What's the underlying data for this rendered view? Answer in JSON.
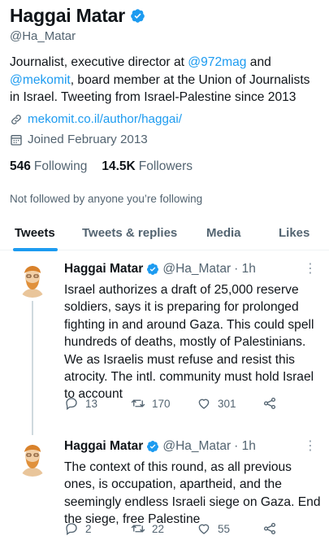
{
  "profile": {
    "display_name": "Haggai Matar",
    "handle": "@Ha_Matar",
    "bio_part1": "Journalist, executive director at ",
    "bio_mention1": "@972mag",
    "bio_part2": " and ",
    "bio_mention2": "@mekomit",
    "bio_part3": ", board member at the Union of Journalists in Israel. Tweeting from Israel-Palestine since 2013",
    "link": "mekomit.co.il/author/haggai/",
    "joined": "Joined February 2013",
    "following_count": "546",
    "following_label": "Following",
    "followers_count": "14.5K",
    "followers_label": "Followers",
    "not_followed": "Not followed by anyone you’re following"
  },
  "tabs": [
    "Tweets",
    "Tweets & replies",
    "Media",
    "Likes"
  ],
  "tweets": [
    {
      "name": "Haggai Matar",
      "handle": "@Ha_Matar",
      "time": "· 1h",
      "text": "Israel authorizes a draft of 25,000 reserve soldiers, says it is preparing for prolonged fighting in and around Gaza. This could spell hundreds of deaths, mostly of Palestinians. We as Israelis must refuse and resist this atrocity. The intl. community must hold Israel to account",
      "replies": "13",
      "retweets": "170",
      "likes": "301"
    },
    {
      "name": "Haggai Matar",
      "handle": "@Ha_Matar",
      "time": "· 1h",
      "text": "The context of this round, as all previous ones, is occupation, apartheid, and the seemingly endless Israeli siege on Gaza. End the siege, free Palestine",
      "replies": "2",
      "retweets": "22",
      "likes": "55"
    }
  ],
  "icons": {
    "verified": "verified-badge-icon",
    "link": "link-icon",
    "calendar": "calendar-icon",
    "reply": "reply-icon",
    "retweet": "retweet-icon",
    "like": "heart-icon",
    "share": "share-icon",
    "more": "more-icon"
  },
  "colors": {
    "accent": "#1d9bf0",
    "secondary_text": "#536471",
    "primary_text": "#0f1419"
  }
}
